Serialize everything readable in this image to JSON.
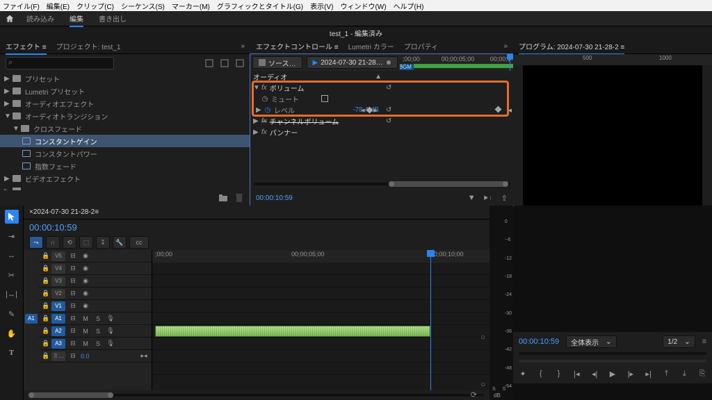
{
  "menu": {
    "items": [
      "ファイル(F)",
      "編集(E)",
      "クリップ(C)",
      "シーケンス(S)",
      "マーカー(M)",
      "グラフィックとタイトル(G)",
      "表示(V)",
      "ウィンドウ(W)",
      "ヘルプ(H)"
    ]
  },
  "title": "test_1 - 編集済み",
  "workspaces": {
    "items": [
      "読み込み",
      "編集",
      "書き出し"
    ],
    "active": 1
  },
  "left_panel": {
    "tabs": [
      "エフェクト",
      "プロジェクト: test_1"
    ],
    "active": 0,
    "search_placeholder": "",
    "tree": [
      {
        "label": "プリセット",
        "type": "folder",
        "depth": 0,
        "chev": "▶"
      },
      {
        "label": "Lumetri プリセット",
        "type": "folder",
        "depth": 0,
        "chev": "▶"
      },
      {
        "label": "オーディオエフェクト",
        "type": "folder",
        "depth": 0,
        "chev": "▶"
      },
      {
        "label": "オーディオトランジション",
        "type": "folder",
        "depth": 0,
        "chev": "▼"
      },
      {
        "label": "クロスフェード",
        "type": "folder",
        "depth": 1,
        "chev": "▼"
      },
      {
        "label": "コンスタントゲイン",
        "type": "fx",
        "depth": 2,
        "sel": true
      },
      {
        "label": "コンスタントパワー",
        "type": "fx",
        "depth": 2
      },
      {
        "label": "指数フェード",
        "type": "fx",
        "depth": 2
      },
      {
        "label": "ビデオエフェクト",
        "type": "folder",
        "depth": 0,
        "chev": "▶"
      }
    ]
  },
  "effect_controls": {
    "tabs": [
      "エフェクトコントロール",
      "Lumetri カラー",
      "プロパティ"
    ],
    "active": 0,
    "source_label": "ソース…",
    "clip_label": "2024-07-30 21-28…",
    "timeMarks": [
      ";00;00",
      "00;00;05;00",
      "00;00;1"
    ],
    "bgm": "BGM",
    "section_audio": "オーディオ",
    "rows": [
      {
        "chev": "▼",
        "fx": "fx",
        "label": "ボリューム",
        "reset": true
      },
      {
        "stopwatch": true,
        "label": "ミュート",
        "checkbox": true
      },
      {
        "chev": "▶",
        "stopwatch": true,
        "label": "レベル",
        "value": "-78.4 dB",
        "keyframe": true,
        "reset": true,
        "diamonds": true
      },
      {
        "chev": "▶",
        "fx": "fx",
        "label": "チャンネルボリューム",
        "reset": true,
        "strike": true
      },
      {
        "chev": "▶",
        "fx": "fx",
        "label": "パンナー"
      }
    ],
    "timecode": "00:00:10:59"
  },
  "program": {
    "title": "プログラム: 2024-07-30 21-28-2",
    "ruler": [
      "500",
      "1000"
    ],
    "timecode": "00:00:10:59",
    "fit": "全体表示",
    "zoom": "1/2"
  },
  "timeline": {
    "seq_name": "2024-07-30 21-28-2",
    "timecode": "00:00:10:59",
    "ruler": [
      ";00;00",
      "00;00;05;00",
      "00;00;10;00"
    ],
    "video_tracks": [
      "V5",
      "V4",
      "V3",
      "V2",
      "V1"
    ],
    "audio_tracks": [
      "A1",
      "A2",
      "A3",
      "ミ…"
    ],
    "audio_val": "0.0",
    "src_patch": "A1",
    "playhead_pct": 77
  },
  "meter": {
    "scale": [
      "0",
      "--6",
      "-12",
      "-18",
      "-24",
      "-30",
      "-36",
      "-42",
      "-48",
      "-54"
    ],
    "unit": "dB",
    "solo": "S  S"
  }
}
